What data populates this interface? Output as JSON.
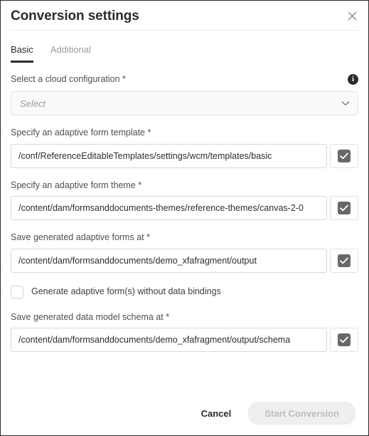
{
  "dialog": {
    "title": "Conversion settings",
    "close_icon": "close-icon"
  },
  "tabs": [
    {
      "label": "Basic",
      "active": true
    },
    {
      "label": "Additional",
      "active": false
    }
  ],
  "fields": {
    "cloud_config": {
      "label": "Select a cloud configuration *",
      "placeholder": "Select",
      "value": "",
      "info_tooltip_icon": "info-icon",
      "chevron_icon": "chevron-down-icon"
    },
    "form_template": {
      "label": "Specify an adaptive form template *",
      "value": "/conf/ReferenceEditableTemplates/settings/wcm/templates/basic",
      "confirm_icon": "check-icon"
    },
    "form_theme": {
      "label": "Specify an adaptive form theme *",
      "value": "/content/dam/formsanddocuments-themes/reference-themes/canvas-2-0",
      "confirm_icon": "check-icon"
    },
    "forms_output": {
      "label": "Save generated adaptive forms at *",
      "value": "/content/dam/formsanddocuments/demo_xfafragment/output",
      "confirm_icon": "check-icon"
    },
    "without_bindings": {
      "label": "Generate adaptive form(s) without data bindings",
      "checked": false
    },
    "schema_output": {
      "label": "Save generated data model schema at *",
      "value": "/content/dam/formsanddocuments/demo_xfafragment/output/schema",
      "confirm_icon": "check-icon"
    }
  },
  "footer": {
    "cancel_label": "Cancel",
    "submit_label": "Start Conversion",
    "submit_disabled": true
  },
  "colors": {
    "text_primary": "#2c2c2c",
    "text_label": "#4f4f4f",
    "text_muted": "#9b9b9b",
    "border": "#d8d8d8",
    "checkbox_fill": "#686868",
    "disabled_button_bg": "#efefef"
  }
}
